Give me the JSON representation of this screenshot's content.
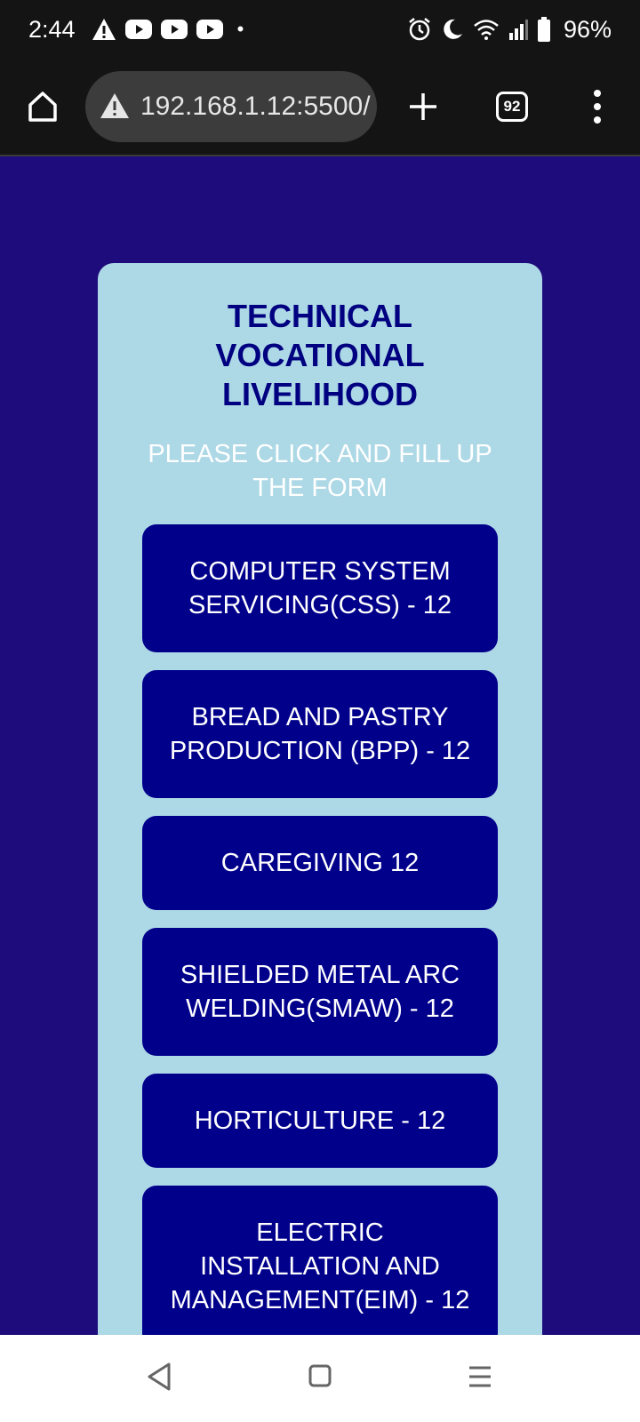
{
  "status_bar": {
    "time": "2:44",
    "battery": "96%",
    "left_icons": [
      "warning-icon",
      "youtube-icon",
      "youtube-icon",
      "youtube-icon",
      "dot-icon"
    ],
    "right_icons": [
      "alarm-icon",
      "moon-icon",
      "wifi-icon",
      "signal-icon",
      "battery-icon"
    ]
  },
  "browser": {
    "url": "192.168.1.12:5500/",
    "tab_count": "92",
    "icons": [
      "home-icon",
      "warning-icon",
      "plus-icon",
      "tabs-icon",
      "menu-dots-icon"
    ]
  },
  "card": {
    "title": "TECHNICAL VOCATIONAL LIVELIHOOD",
    "subtitle": "PLEASE CLICK AND FILL UP THE FORM",
    "courses": [
      {
        "label": "COMPUTER SYSTEM SERVICING(CSS) - 12"
      },
      {
        "label": "BREAD AND PASTRY PRODUCTION (BPP) - 12"
      },
      {
        "label": "CAREGIVING 12"
      },
      {
        "label": "SHIELDED METAL ARC WELDING(SMAW) - 12"
      },
      {
        "label": "HORTICULTURE - 12"
      },
      {
        "label": "ELECTRIC INSTALLATION AND MANAGEMENT(EIM) - 12"
      }
    ]
  },
  "colors": {
    "page_background": "#1f0c7c",
    "card_background": "#add8e6",
    "title_color": "#000080",
    "button_background": "#00008b",
    "button_text": "#ffffff"
  },
  "nav_bar": {
    "icons": [
      "back-icon",
      "home-square-icon",
      "recents-icon"
    ]
  }
}
